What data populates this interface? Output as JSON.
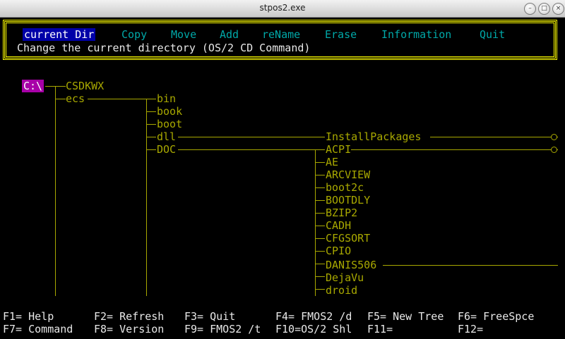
{
  "window": {
    "title": "stpos2.exe",
    "buttons": [
      "minimize",
      "maximize",
      "close"
    ],
    "button_glyphs": {
      "minimize": "–",
      "maximize": "□",
      "close": "×"
    }
  },
  "menu": {
    "items": [
      "current Dir",
      "Copy",
      "Move",
      "Add",
      "reName",
      "Erase",
      "Information",
      "Quit"
    ],
    "selected": "current Dir",
    "description": "Change the current directory (OS/2 CD Command)"
  },
  "tree": {
    "root": "C:\\",
    "level1": [
      "CSDKWX",
      "ecs"
    ],
    "ecs_children": [
      "bin",
      "book",
      "boot",
      "dll",
      "DOC"
    ],
    "dll_children": [
      "InstallPackages"
    ],
    "doc_children": [
      "ACPI",
      "AE",
      "ARCVIEW",
      "boot2c",
      "BOOTDLY",
      "BZIP2",
      "CADH",
      "CFGSORT",
      "CPIO",
      "DANIS506",
      "DejaVu",
      "droid"
    ]
  },
  "function_keys": {
    "row1": [
      "F1= Help",
      "F2= Refresh",
      "F3= Quit",
      "F4= FMOS2 /d",
      "F5= New Tree",
      "F6= FreeSpce"
    ],
    "row2": [
      "F7= Command",
      "F8= Version",
      "F9= FMOS2 /t",
      "F10=OS/2 Shl",
      "F11=",
      "F12="
    ]
  },
  "colors": {
    "background": "#000000",
    "menu_border": "#ffff00",
    "menu_item": "#00a8a8",
    "menu_selected_bg": "#0000a8",
    "tree_text": "#a8a800",
    "root_highlight": "#a800a8",
    "text": "#e8e8e8"
  }
}
